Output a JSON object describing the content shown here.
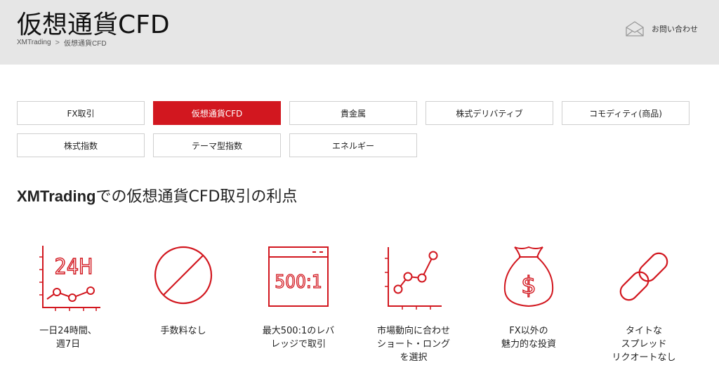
{
  "header": {
    "title": "仮想通貨CFD",
    "breadcrumb": [
      "XMTrading",
      "仮想通貨CFD"
    ],
    "breadcrumb_separator": ">",
    "contact_label": "お問い合わせ",
    "contact_icon": "envelope-icon"
  },
  "tabs": [
    {
      "label": "FX取引",
      "active": false
    },
    {
      "label": "仮想通貨CFD",
      "active": true
    },
    {
      "label": "貴金属",
      "active": false
    },
    {
      "label": "株式デリバティブ",
      "active": false
    },
    {
      "label": "コモディティ(商品)",
      "active": false
    },
    {
      "label": "株式指数",
      "active": false
    },
    {
      "label": "テーマ型指数",
      "active": false
    },
    {
      "label": "エネルギー",
      "active": false
    }
  ],
  "section": {
    "title_prefix": "XMTrading",
    "title_suffix": "での仮想通貨CFD取引の利点"
  },
  "features": [
    {
      "icon": "clock-chart-icon",
      "icon_text": "24H",
      "label": "一日24時間、\n週7日"
    },
    {
      "icon": "no-fee-icon",
      "label": "手数料なし"
    },
    {
      "icon": "leverage-window-icon",
      "icon_text": "500:1",
      "label": "最大500:1のレバ\nレッジで取引"
    },
    {
      "icon": "trend-chart-icon",
      "label": "市場動向に合わせ\nショート・ロング\nを選択"
    },
    {
      "icon": "money-bag-icon",
      "icon_text": "$",
      "label": "FX以外の\n魅力的な投資"
    },
    {
      "icon": "chain-link-icon",
      "label": "タイトな\nスプレッド\nリクオートなし"
    }
  ],
  "colors": {
    "accent": "#d2171f",
    "header_bg": "#e6e6e6",
    "tab_border": "#cfcfcf"
  }
}
